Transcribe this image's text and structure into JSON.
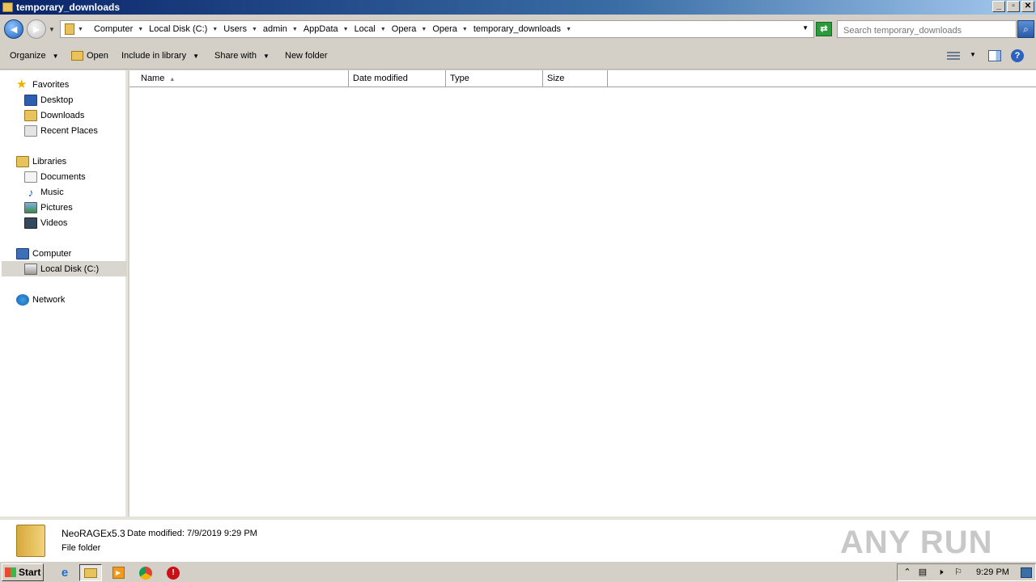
{
  "window": {
    "title": "temporary_downloads",
    "controls": {
      "minimize": "_",
      "restore": "▫",
      "close": "✕"
    }
  },
  "address": {
    "breadcrumbs": [
      "Computer",
      "Local Disk (C:)",
      "Users",
      "admin",
      "AppData",
      "Local",
      "Opera",
      "Opera",
      "temporary_downloads"
    ],
    "search_placeholder": "Search temporary_downloads"
  },
  "toolbar": {
    "organize": "Organize",
    "open": "Open",
    "include_in_library": "Include in library",
    "share_with": "Share with",
    "new_folder": "New folder"
  },
  "nav": {
    "favorites": {
      "label": "Favorites",
      "items": [
        "Desktop",
        "Downloads",
        "Recent Places"
      ]
    },
    "libraries": {
      "label": "Libraries",
      "items": [
        "Documents",
        "Music",
        "Pictures",
        "Videos"
      ]
    },
    "computer": {
      "label": "Computer",
      "items": [
        "Local Disk (C:)"
      ]
    },
    "network": {
      "label": "Network"
    },
    "selected": "Local Disk (C:)"
  },
  "columns": [
    "Name",
    "Date modified",
    "Type",
    "Size"
  ],
  "sort": {
    "column": "Name",
    "direction": "ascending"
  },
  "details": {
    "name": "NeoRAGEx5.3",
    "date_modified": "Date modified: 7/9/2019 9:29 PM",
    "type": "File folder"
  },
  "watermark": "ANY RUN",
  "taskbar": {
    "start": "Start",
    "clock": "9:29 PM"
  },
  "colors": {
    "title_gradient_start": "#0a246a",
    "title_gradient_end": "#a6caf0",
    "chrome": "#d4d0c8"
  }
}
